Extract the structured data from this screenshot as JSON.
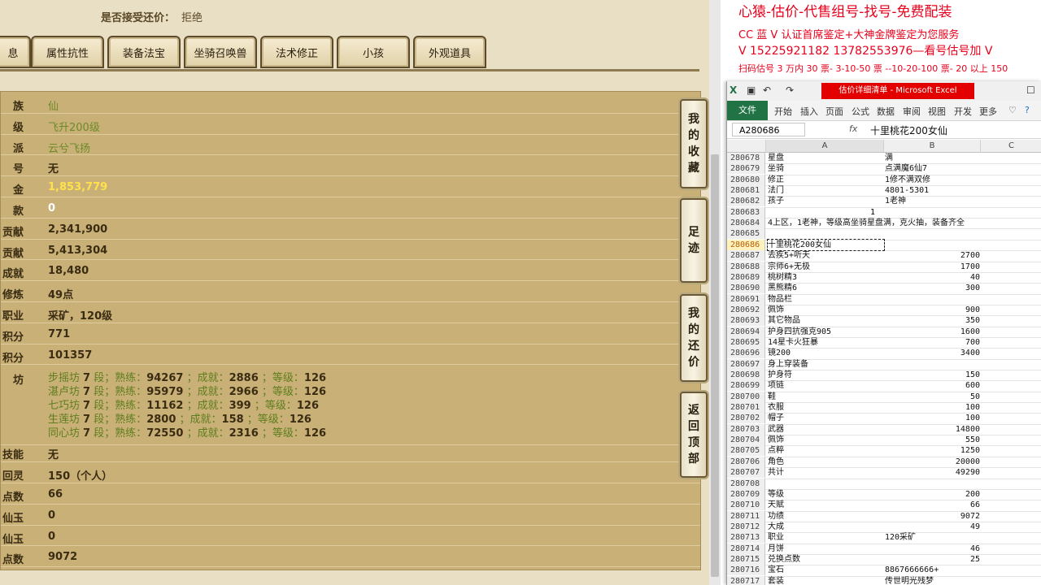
{
  "game": {
    "accept_counter_label": "是否接受还价：",
    "accept_counter_value": "拒绝",
    "tabs": [
      "息",
      "属性抗性",
      "装备法宝",
      "坐骑召唤兽",
      "法术修正",
      "小孩",
      "外观道具"
    ],
    "rows": [
      {
        "label": "族",
        "value": "仙",
        "style": "g"
      },
      {
        "label": "级",
        "value": "飞升200级",
        "style": "g"
      },
      {
        "label": "派",
        "value": "云兮飞扬",
        "style": "g"
      },
      {
        "label": "号",
        "value": "无",
        "style": "d"
      },
      {
        "label": "金",
        "value": "1,853,779",
        "style": "y"
      },
      {
        "label": "款",
        "value": "0",
        "style": "w"
      },
      {
        "label": "贡献",
        "value": "2,341,900",
        "style": "d"
      },
      {
        "label": "贡献",
        "value": "5,413,304",
        "style": "d"
      },
      {
        "label": "成就",
        "value": "18,480",
        "style": "d"
      },
      {
        "label": "修炼",
        "value": "49点",
        "style": "d"
      },
      {
        "label": "职业",
        "value": "采矿，120级",
        "style": "d"
      },
      {
        "label": "积分",
        "value": "771",
        "style": "d"
      },
      {
        "label": "积分",
        "value": "101357",
        "style": "d"
      }
    ],
    "workshop_label": "坊",
    "workshops": [
      {
        "name": "步摇坊",
        "level": "7",
        "skill": "94267",
        "achv": "2886",
        "grade": "126"
      },
      {
        "name": "湛卢坊",
        "level": "7",
        "skill": "95979",
        "achv": "2966",
        "grade": "126"
      },
      {
        "name": "七巧坊",
        "level": "7",
        "skill": "11162",
        "achv": "399",
        "grade": "126"
      },
      {
        "name": "生莲坊",
        "level": "7",
        "skill": "2800",
        "achv": "158",
        "grade": "126"
      },
      {
        "name": "同心坊",
        "level": "7",
        "skill": "72550",
        "achv": "2316",
        "grade": "126"
      }
    ],
    "workshop_words": {
      "seg": "段；熟练：",
      "achv": "；成就：",
      "grade": "；等级："
    },
    "rows2": [
      {
        "label": "技能",
        "value": "无",
        "style": "d"
      },
      {
        "label": "回灵",
        "value": "150（个人）",
        "style": "d"
      },
      {
        "label": "点数",
        "value": "66",
        "style": "d"
      },
      {
        "label": "仙玉",
        "value": "0",
        "style": "d"
      },
      {
        "label": "仙玉",
        "value": "0",
        "style": "d"
      },
      {
        "label": "点数",
        "value": "9072",
        "style": "d"
      }
    ],
    "side_buttons": [
      "我的收藏",
      "足迹",
      "我的还价",
      "返回顶部"
    ]
  },
  "promo": {
    "line1": "心猿-估价-代售组号-找号-免费配装",
    "line2": "CC 蓝 V 认证首席鉴定+大神金牌鉴定为您服务",
    "line3": "V 15225921182      13782553976—看号估号加 V",
    "line4": "扫码估号 3 万内 30 票- 3-10-50 票  --10-20-100 票- 20 以上 150"
  },
  "excel": {
    "title": "估价详细清单 - Microsoft Excel",
    "ribbon_file": "文件",
    "ribbon_tabs": [
      "开始",
      "插入",
      "页面",
      "公式",
      "数据",
      "审阅",
      "视图",
      "开发",
      "更多"
    ],
    "name_box": "A280686",
    "fx": "fx",
    "formula": "十里桃花200女仙",
    "columns": [
      "A",
      "B",
      "C"
    ],
    "selected_row": "280686",
    "rows": [
      {
        "n": "280678",
        "a": "星盘",
        "b": "满",
        "num": false
      },
      {
        "n": "280679",
        "a": "坐骑",
        "b": "点满魔6仙7",
        "num": false
      },
      {
        "n": "280680",
        "a": "修正",
        "b": "1修不满双修",
        "num": false
      },
      {
        "n": "280681",
        "a": "法门",
        "b": "4801-5301",
        "num": false
      },
      {
        "n": "280682",
        "a": "孩子",
        "b": "1老神",
        "num": false
      },
      {
        "n": "280683",
        "a": "",
        "b": "",
        "num": false,
        "mid": "1"
      },
      {
        "n": "280684",
        "a": "4上区，1老神，等级高坐骑星盘满，克火抽，装备齐全",
        "b": "",
        "num": false
      },
      {
        "n": "280685",
        "a": "",
        "b": "",
        "num": false
      },
      {
        "n": "280686",
        "a": "十里桃花200女仙",
        "b": "",
        "num": false
      },
      {
        "n": "280687",
        "a": "去疾5+听天",
        "b": "2700",
        "num": true
      },
      {
        "n": "280688",
        "a": "宗师6+无极",
        "b": "1700",
        "num": true
      },
      {
        "n": "280689",
        "a": "桃树精3",
        "b": "40",
        "num": true
      },
      {
        "n": "280690",
        "a": "黑熊精6",
        "b": "300",
        "num": true
      },
      {
        "n": "280691",
        "a": "物品栏",
        "b": "",
        "num": false
      },
      {
        "n": "280692",
        "a": "佩饰",
        "b": "900",
        "num": true
      },
      {
        "n": "280693",
        "a": "其它物品",
        "b": "350",
        "num": true
      },
      {
        "n": "280694",
        "a": "护身四抗强克905",
        "b": "1600",
        "num": true
      },
      {
        "n": "280695",
        "a": "14星卡火狂暴",
        "b": "700",
        "num": true
      },
      {
        "n": "280696",
        "a": "镜200",
        "b": "3400",
        "num": true
      },
      {
        "n": "280697",
        "a": "身上穿装备",
        "b": "",
        "num": false
      },
      {
        "n": "280698",
        "a": "护身符",
        "b": "150",
        "num": true
      },
      {
        "n": "280699",
        "a": "项链",
        "b": "600",
        "num": true
      },
      {
        "n": "280700",
        "a": "鞋",
        "b": "50",
        "num": true
      },
      {
        "n": "280701",
        "a": "衣服",
        "b": "100",
        "num": true
      },
      {
        "n": "280702",
        "a": "帽子",
        "b": "100",
        "num": true
      },
      {
        "n": "280703",
        "a": "武器",
        "b": "14800",
        "num": true
      },
      {
        "n": "280704",
        "a": "佩饰",
        "b": "550",
        "num": true
      },
      {
        "n": "280705",
        "a": "点粹",
        "b": "1250",
        "num": true
      },
      {
        "n": "280706",
        "a": "角色",
        "b": "20000",
        "num": true
      },
      {
        "n": "280707",
        "a": "共计",
        "b": "49290",
        "num": true
      },
      {
        "n": "280708",
        "a": "",
        "b": "",
        "num": false
      },
      {
        "n": "280709",
        "a": "等级",
        "b": "200",
        "num": true
      },
      {
        "n": "280710",
        "a": "天赋",
        "b": "66",
        "num": true
      },
      {
        "n": "280711",
        "a": "功绩",
        "b": "9072",
        "num": true
      },
      {
        "n": "280712",
        "a": "大成",
        "b": "49",
        "num": true
      },
      {
        "n": "280713",
        "a": "职业",
        "b": "120采矿",
        "num": false
      },
      {
        "n": "280714",
        "a": "月饼",
        "b": "46",
        "num": true
      },
      {
        "n": "280715",
        "a": "兑换点数",
        "b": "25",
        "num": true
      },
      {
        "n": "280716",
        "a": "宝石",
        "b": "8867666666+",
        "num": false
      },
      {
        "n": "280717",
        "a": "套装",
        "b": "传世明光残梦",
        "num": false
      }
    ]
  }
}
